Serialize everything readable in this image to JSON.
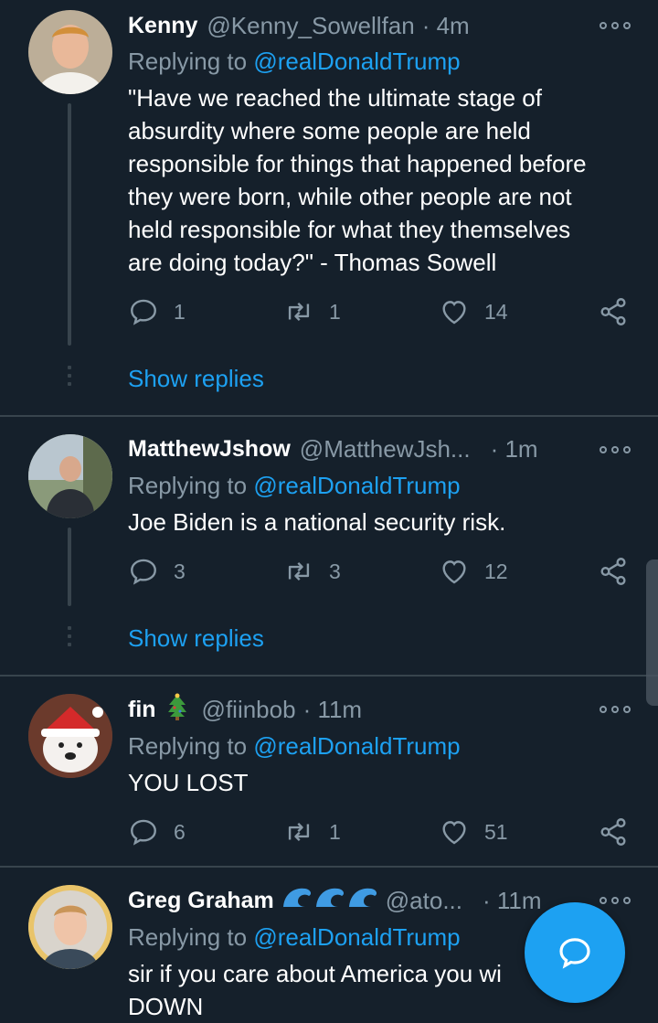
{
  "colors": {
    "background": "#15202b",
    "accent": "#1da1f2",
    "muted": "#8899a6",
    "divider": "#38444d"
  },
  "tweets": [
    {
      "name": "Kenny",
      "handle": "@Kenny_Sowellfan",
      "time": "· 4m",
      "replying_label": "Replying to",
      "replying_to": "@realDonaldTrump",
      "lines": [
        "\"Have we reached the ultimate stage of",
        "absurdity where some people are held",
        "responsible for things that happened before",
        "they were born, while other people are not",
        "held responsible for what they themselves",
        "are doing today?\" - Thomas Sowell"
      ],
      "replies": "1",
      "retweets": "1",
      "likes": "14",
      "show_replies": "Show replies"
    },
    {
      "name": "MatthewJshow",
      "handle": "@MatthewJsh...",
      "time": "· 1m",
      "replying_label": "Replying to",
      "replying_to": "@realDonaldTrump",
      "lines": [
        "Joe Biden is a national security risk."
      ],
      "replies": "3",
      "retweets": "3",
      "likes": "12",
      "show_replies": "Show replies"
    },
    {
      "name": "fin",
      "name_emoji": "christmas-tree-icon",
      "handle": "@fiinbob",
      "time": "· 11m",
      "replying_label": "Replying to",
      "replying_to": "@realDonaldTrump",
      "lines": [
        "YOU LOST"
      ],
      "replies": "6",
      "retweets": "1",
      "likes": "51"
    },
    {
      "name": "Greg Graham",
      "name_emoji": "wave-icon",
      "handle": "@ato...",
      "time": "· 11m",
      "replying_label": "Replying to",
      "replying_to": "@realDonaldTrump",
      "lines": [
        "sir if you care about America you wi",
        "DOWN"
      ]
    }
  ],
  "fab": {
    "icon": "compose-reply-icon"
  }
}
